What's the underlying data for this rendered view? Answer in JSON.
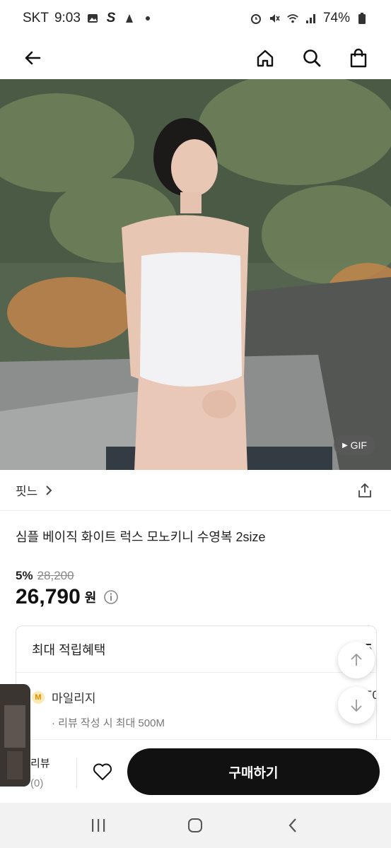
{
  "status_bar": {
    "carrier": "SKT",
    "time": "9:03",
    "battery": "74%",
    "left_icons": [
      "gallery-icon",
      "s-app-icon",
      "app-icon",
      "dot-icon"
    ],
    "right_icons": [
      "alarm-icon",
      "mute-icon",
      "wifi-icon",
      "signal-icon",
      "battery-icon"
    ]
  },
  "header": {
    "icons": [
      "back-arrow-icon",
      "home-icon",
      "search-icon",
      "shopping-bag-icon"
    ]
  },
  "product": {
    "gif_badge": "GIF",
    "brand": "핏느",
    "title": "심플 베이직 화이트 럭스 모노키니 수영복 2size",
    "discount_rate": "5%",
    "original_price": "28,200",
    "price": "26,790",
    "currency": "원"
  },
  "benefit": {
    "heading": "최대 적립혜택",
    "total": "+ 5",
    "mileage_badge": "M",
    "mileage_label": "마일리지",
    "mileage_value": "50",
    "mileage_note": "· 리뷰 작성 시 최대 500M"
  },
  "bottom_bar": {
    "review_label": "리뷰",
    "review_count": "(0)",
    "buy_label": "구매하기"
  },
  "nav": {
    "icons": [
      "recent-apps-icon",
      "home-nav-icon",
      "back-nav-icon"
    ]
  },
  "colors": {
    "primary_button": "#111111",
    "mileage_badge_bg": "#fde9b6",
    "mileage_badge_text": "#e08a00"
  }
}
